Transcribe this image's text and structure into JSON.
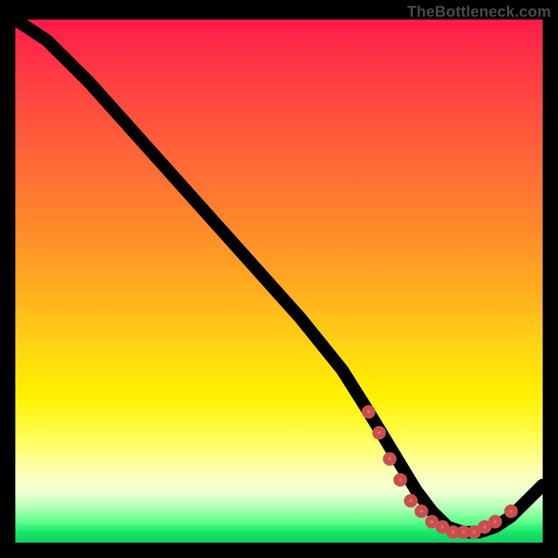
{
  "watermark": "TheBottleneck.com",
  "colors": {
    "curve": "#000000",
    "marker_fill": "#e86a6a",
    "marker_stroke": "#c94f4f"
  },
  "chart_data": {
    "type": "line",
    "title": "",
    "xlabel": "",
    "ylabel": "",
    "xlim": [
      0,
      100
    ],
    "ylim": [
      0,
      100
    ],
    "grid": false,
    "legend": null,
    "series": [
      {
        "name": "bottleneck-curve",
        "x": [
          0,
          6,
          14,
          22,
          30,
          38,
          46,
          54,
          62,
          67,
          70,
          73,
          76,
          79,
          82,
          85,
          88,
          91,
          94,
          100
        ],
        "y": [
          100,
          96,
          88,
          79,
          70,
          61,
          52,
          43,
          33,
          25,
          20,
          15,
          10,
          6,
          3,
          2,
          2,
          3,
          5,
          11
        ]
      }
    ],
    "markers": [
      {
        "x": 67,
        "y": 25
      },
      {
        "x": 69,
        "y": 21
      },
      {
        "x": 71,
        "y": 16
      },
      {
        "x": 73,
        "y": 12
      },
      {
        "x": 75,
        "y": 8
      },
      {
        "x": 77,
        "y": 6
      },
      {
        "x": 79,
        "y": 4
      },
      {
        "x": 81,
        "y": 3
      },
      {
        "x": 83,
        "y": 2
      },
      {
        "x": 85,
        "y": 2
      },
      {
        "x": 87,
        "y": 2
      },
      {
        "x": 89,
        "y": 3
      },
      {
        "x": 91,
        "y": 4
      },
      {
        "x": 94,
        "y": 6
      }
    ],
    "marker_radius": 6,
    "gradient_stops": [
      {
        "pos": 0.0,
        "color": "#ff1a4b"
      },
      {
        "pos": 0.4,
        "color": "#ff8a2a"
      },
      {
        "pos": 0.72,
        "color": "#fff200"
      },
      {
        "pos": 0.9,
        "color": "#f2ffd2"
      },
      {
        "pos": 1.0,
        "color": "#0fd060"
      }
    ]
  }
}
